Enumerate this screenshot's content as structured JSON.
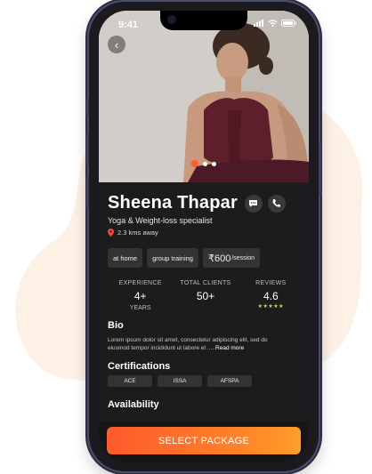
{
  "status_bar": {
    "time": "9:41"
  },
  "trainer": {
    "name": "Sheena Thapar",
    "specialty": "Yoga & Weight-loss specialist",
    "distance": "2.3 kms away"
  },
  "chips": {
    "mode_1": "at home",
    "mode_2": "group training",
    "price": "₹600",
    "price_unit": "/session"
  },
  "stats": {
    "experience_label": "EXPERIENCE",
    "experience_value": "4+",
    "experience_unit": "YEARS",
    "clients_label": "TOTAL CLIENTS",
    "clients_value": "50+",
    "reviews_label": "REVIEWS",
    "reviews_value": "4.6",
    "stars": "★★★★★"
  },
  "bio": {
    "title": "Bio",
    "text": "Lorem ipsum dolor sit amet, consectetur adipiscing elit, sed do eiusmod tempor incididunt ut labore et .....",
    "read_more": "Read more"
  },
  "certifications": {
    "title": "Certifications",
    "items": [
      "ACE",
      "ISSA",
      "AFSPA"
    ]
  },
  "availability": {
    "title": "Availability"
  },
  "cta": {
    "label": "SELECT PACKAGE"
  },
  "carousel": {
    "active_index": 0,
    "count": 3
  },
  "colors": {
    "accent": "#ff5a2a",
    "background": "#1c1c1e",
    "chip": "#333336",
    "stars": "#c8e43a"
  }
}
